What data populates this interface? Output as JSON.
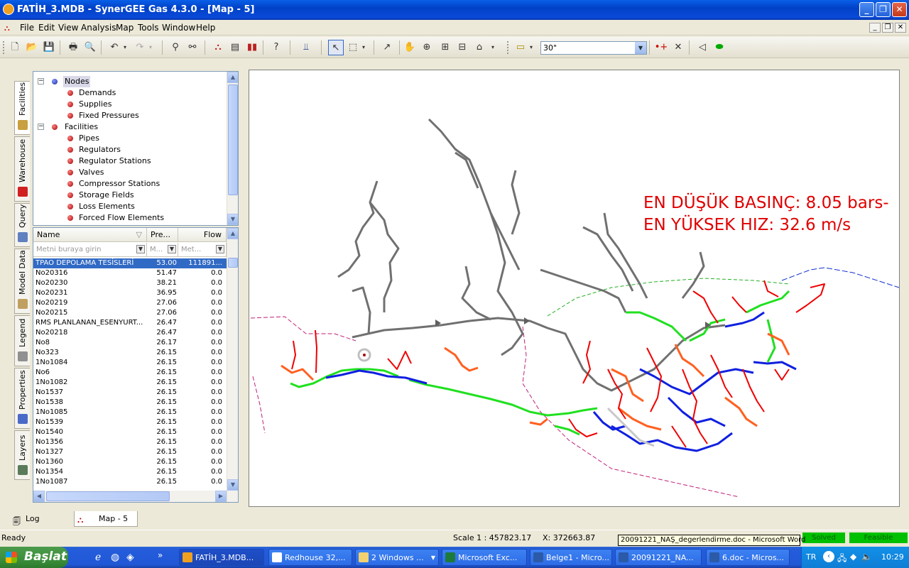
{
  "window": {
    "title": "FATİH_3.MDB - SynerGEE Gas 4.3.0 - [Map - 5]"
  },
  "menu": [
    "File",
    "Edit",
    "View",
    "Analysis",
    "Map",
    "Tools",
    "Window",
    "Help"
  ],
  "toolbar": {
    "zoom_value": "30\""
  },
  "lefttabs": [
    "Facilities",
    "Warehouse",
    "Query",
    "Model Data",
    "Legend",
    "Properties",
    "Layers"
  ],
  "tree": {
    "nodes_label": "Nodes",
    "nodes_children": [
      "Demands",
      "Supplies",
      "Fixed Pressures"
    ],
    "facilities_label": "Facilities",
    "facilities_children": [
      "Pipes",
      "Regulators",
      "Regulator Stations",
      "Valves",
      "Compressor Stations",
      "Storage Fields",
      "Loss Elements",
      "Forced Flow Elements"
    ]
  },
  "grid": {
    "columns": [
      "Name",
      "Pre...",
      "Flow"
    ],
    "filters": [
      "Metni buraya girin",
      "M...",
      "Met..."
    ],
    "rows": [
      [
        "TPAO DEPOLAMA TESİSLERİ",
        "53.00",
        "111891..."
      ],
      [
        "No20316",
        "51.47",
        "0.0"
      ],
      [
        "No20230",
        "38.21",
        "0.0"
      ],
      [
        "No20231",
        "36.95",
        "0.0"
      ],
      [
        "No20219",
        "27.06",
        "0.0"
      ],
      [
        "No20215",
        "27.06",
        "0.0"
      ],
      [
        "RMS PLANLANAN_ESENYURT...",
        "26.47",
        "0.0"
      ],
      [
        "No20218",
        "26.47",
        "0.0"
      ],
      [
        "No8",
        "26.17",
        "0.0"
      ],
      [
        "No323",
        "26.15",
        "0.0"
      ],
      [
        "1No1084",
        "26.15",
        "0.0"
      ],
      [
        "No6",
        "26.15",
        "0.0"
      ],
      [
        "1No1082",
        "26.15",
        "0.0"
      ],
      [
        "No1537",
        "26.15",
        "0.0"
      ],
      [
        "No1538",
        "26.15",
        "0.0"
      ],
      [
        "1No1085",
        "26.15",
        "0.0"
      ],
      [
        "No1539",
        "26.15",
        "0.0"
      ],
      [
        "No1540",
        "26.15",
        "0.0"
      ],
      [
        "No1356",
        "26.15",
        "0.0"
      ],
      [
        "No1327",
        "26.15",
        "0.0"
      ],
      [
        "No1360",
        "26.15",
        "0.0"
      ],
      [
        "No1354",
        "26.15",
        "0.0"
      ],
      [
        "1No1087",
        "26.15",
        "0.0"
      ]
    ]
  },
  "map": {
    "annotation_line1": "EN DÜŞÜK BASINÇ: 8.05 bars-",
    "annotation_line2": "EN YÜKSEK HIZ: 32.6 m/s",
    "annotation_color": "#e00000"
  },
  "bottom_tabs": [
    "Log Explorer",
    "Map - 5"
  ],
  "status": {
    "left": "Ready",
    "scale": "Scale  1 : 457823.17",
    "x": "X: 372663.87",
    "solved": "Solved",
    "feasible": "Feasible"
  },
  "tooltip": "20091221_NAŞ_degerlendirme.doc - Microsoft Word",
  "taskbar": {
    "start": "Başlat",
    "tasks": [
      "FATİH_3.MDB...",
      "Redhouse 32,...",
      "2 Windows ...",
      "Microsoft Exc...",
      "Belge1 - Micro...",
      "20091221_NA...",
      "6.doc - Micros..."
    ],
    "lang": "TR",
    "clock": "10:29"
  }
}
